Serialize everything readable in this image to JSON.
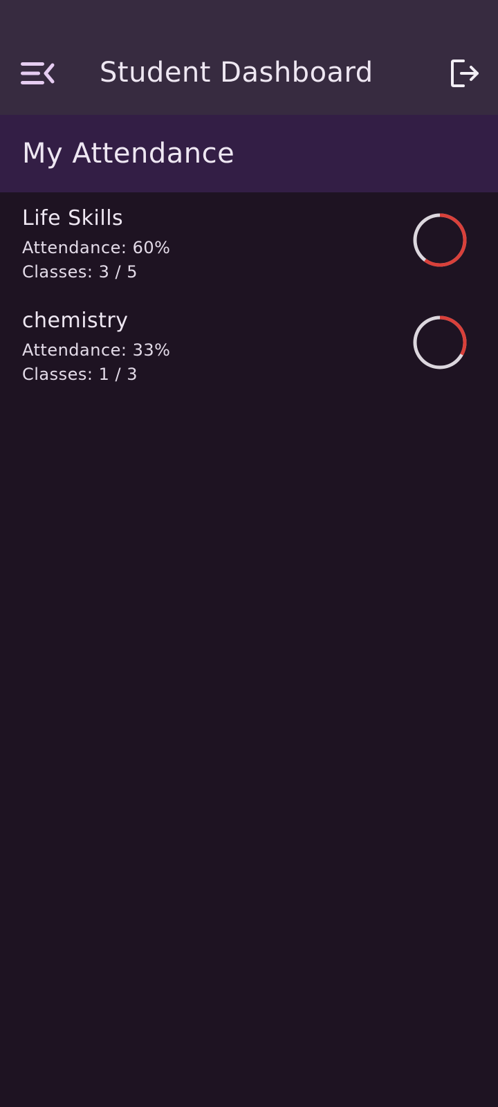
{
  "app_bar": {
    "title": "Student Dashboard",
    "menu_icon": "menu-collapse-icon",
    "logout_icon": "logout-icon"
  },
  "section": {
    "title": "My Attendance"
  },
  "courses": [
    {
      "name": "Life Skills",
      "attendance_text": "Attendance: 60%",
      "classes_text": "Classes: 3 / 5",
      "attendance_fraction": 0.6
    },
    {
      "name": "chemistry",
      "attendance_text": "Attendance: 33%",
      "classes_text": "Classes: 1 / 3",
      "attendance_fraction": 0.33
    }
  ],
  "colors": {
    "background": "#1e1322",
    "app_bar": "#372b40",
    "section_header": "#331e45",
    "progress_fill": "#d9403a",
    "progress_track": "#dcd7de",
    "text": "#eee7f2",
    "menu_icon": "#e6cdf2"
  }
}
